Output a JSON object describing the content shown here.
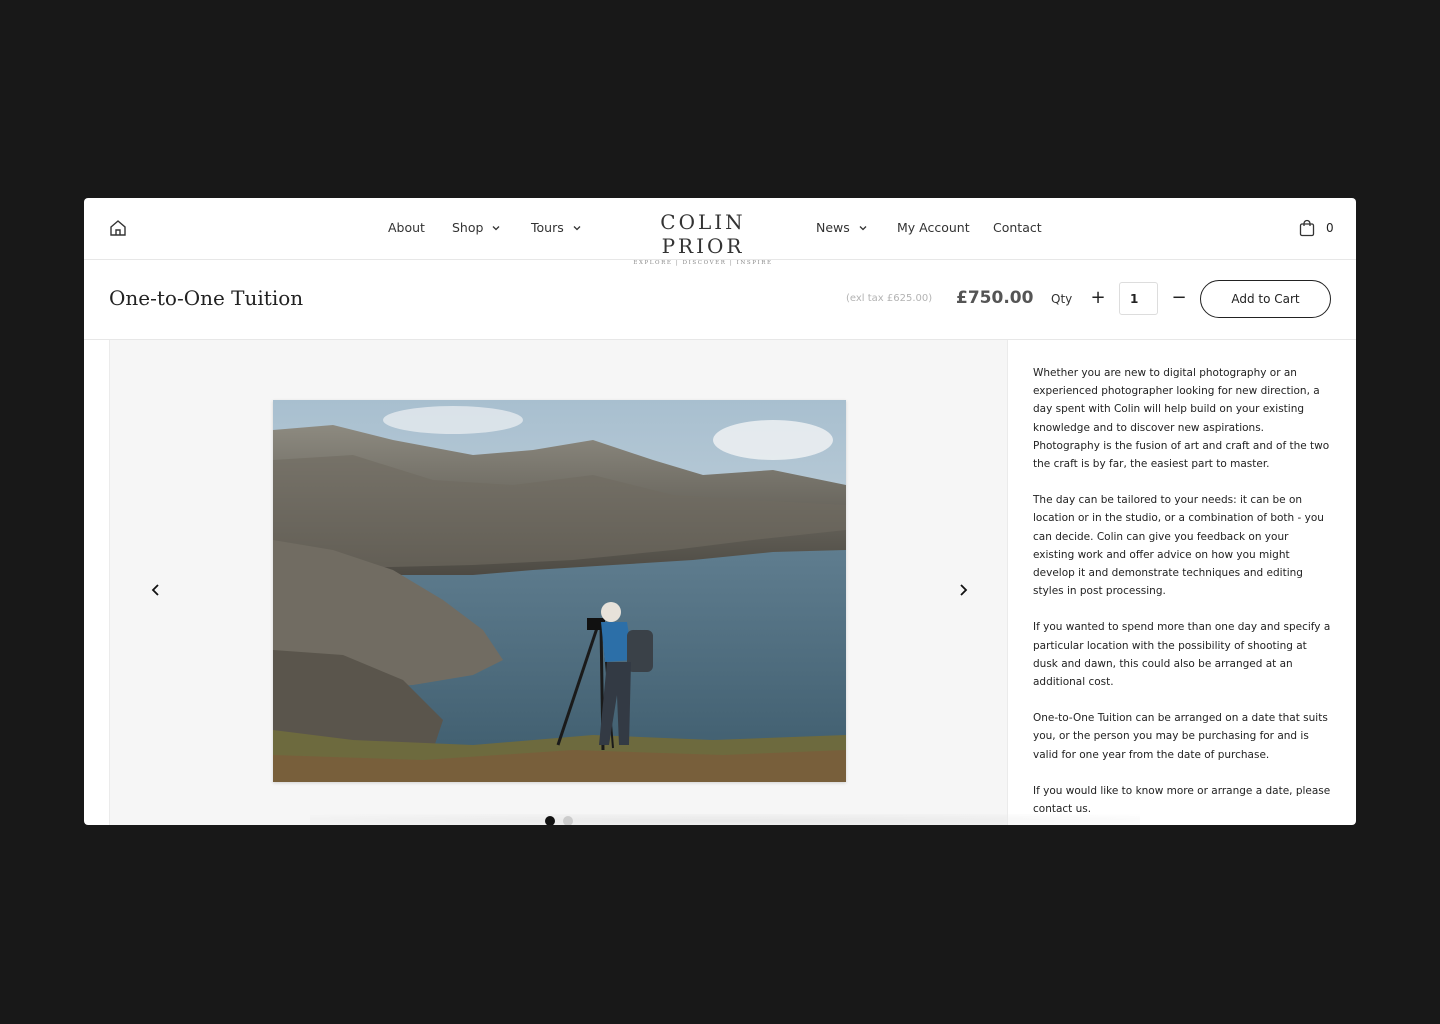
{
  "nav": {
    "about": "About",
    "shop": "Shop",
    "tours": "Tours",
    "news": "News",
    "my_account": "My Account",
    "contact": "Contact"
  },
  "logo": {
    "name": "COLIN PRIOR",
    "tagline": "EXPLORE | DISCOVER | INSPIRE"
  },
  "cart": {
    "count": "0"
  },
  "product": {
    "title": "One-to-One Tuition",
    "ex_tax": "(exl tax £625.00)",
    "price": "£750.00",
    "qty_label": "Qty",
    "qty_value": "1",
    "plus": "+",
    "minus": "−",
    "add_to_cart": "Add to Cart"
  },
  "gallery": {
    "slide_count": 2,
    "active_slide": 1
  },
  "description": [
    "Whether you are new to digital photography or an experienced photographer looking for new direction, a day spent with Colin will help build on your existing knowledge and to discover new aspirations. Photography is the fusion of art and craft and of the two the craft is by far, the easiest part to master.",
    "The day can be tailored to your needs: it can be on location or in the studio, or a combination of both - you can decide. Colin can give you feedback on your existing work and offer advice on how you might develop it and demonstrate techniques and editing styles in post processing.",
    "If you wanted to spend more than one day and specify a particular location with the possibility of shooting at dusk and dawn, this could also be arranged at an additional cost.",
    "One-to-One Tuition can be arranged on a date that suits you, or the person you may be purchasing for and is valid for one year from the date of purchase.",
    "If you would like to know more or arrange a date, please contact us."
  ],
  "icons": [
    "home-icon",
    "chevron-down-icon",
    "cart-icon",
    "chevron-left-icon",
    "chevron-right-icon"
  ]
}
